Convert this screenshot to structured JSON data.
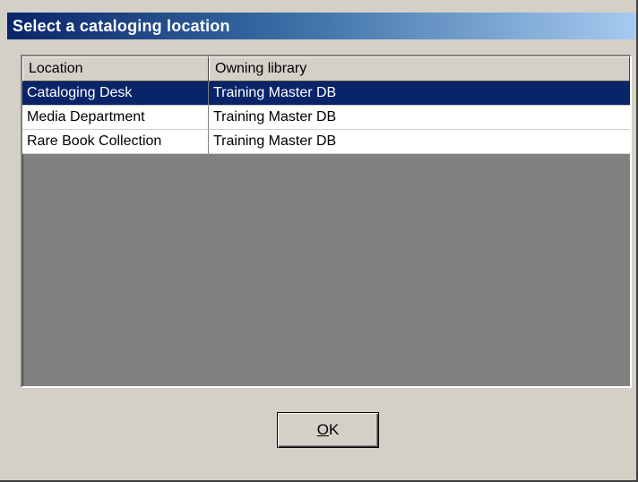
{
  "dialog": {
    "title": "Select a cataloging location"
  },
  "listview": {
    "columns": [
      "Location",
      "Owning library"
    ],
    "rows": [
      {
        "location": "Cataloging Desk",
        "library": "Training Master DB",
        "selected": true
      },
      {
        "location": "Media Department",
        "library": "Training Master DB",
        "selected": false
      },
      {
        "location": "Rare Book Collection",
        "library": "Training Master DB",
        "selected": false
      }
    ]
  },
  "buttons": {
    "ok_mnemonic": "O",
    "ok_rest": "K"
  },
  "colors": {
    "title_gradient_start": "#0a246a",
    "title_gradient_end": "#a6caf0",
    "selection": "#0a246a",
    "dialog_face": "#d4d0c8",
    "list_empty_area": "#808080"
  }
}
